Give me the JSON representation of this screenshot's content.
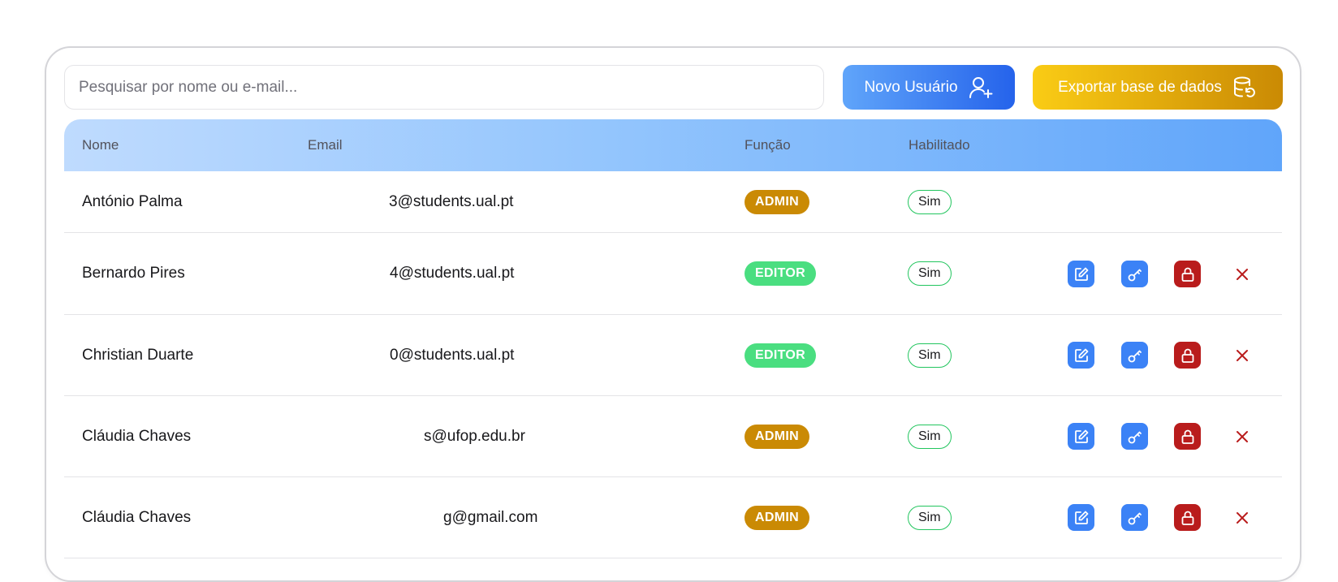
{
  "toolbar": {
    "search_placeholder": "Pesquisar por nome ou e-mail...",
    "new_user_label": "Novo Usuário",
    "export_label": "Exportar base de dados"
  },
  "table": {
    "columns": [
      "Nome",
      "Email",
      "Função",
      "Habilitado"
    ],
    "rows": [
      {
        "name": "António Palma",
        "email": "3@students.ual.pt",
        "role": "ADMIN",
        "enabled": "Sim"
      },
      {
        "name": "Bernardo Pires",
        "email": "4@students.ual.pt",
        "role": "EDITOR",
        "enabled": "Sim"
      },
      {
        "name": "Christian Duarte",
        "email": "0@students.ual.pt",
        "role": "EDITOR",
        "enabled": "Sim"
      },
      {
        "name": "Cláudia Chaves",
        "email": "s@ufop.edu.br",
        "role": "ADMIN",
        "enabled": "Sim"
      },
      {
        "name": "Cláudia Chaves",
        "email": "g@gmail.com",
        "role": "ADMIN",
        "enabled": "Sim"
      }
    ]
  },
  "colors": {
    "admin": "#ca8a04",
    "editor": "#4ade80",
    "action_blue": "#3b82f6",
    "action_red": "#b91c1c"
  },
  "icons": {
    "new_user": "user-plus-icon",
    "export": "database-refresh-icon",
    "edit": "edit-icon",
    "password": "key-icon",
    "lock": "lock-icon",
    "delete": "close-icon"
  }
}
